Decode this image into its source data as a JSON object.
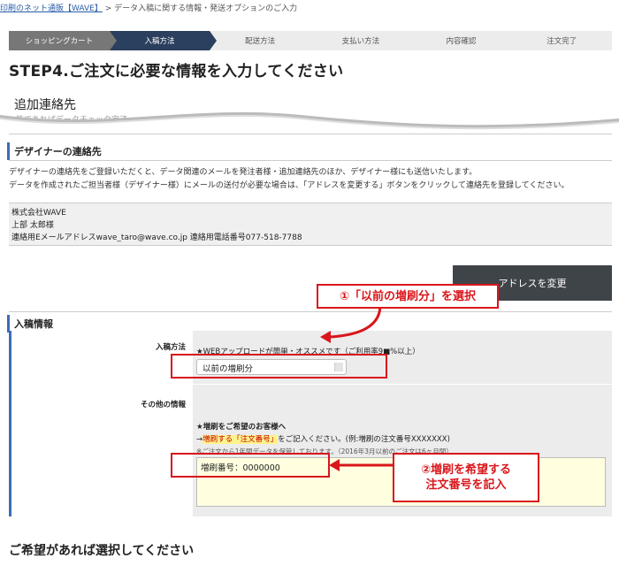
{
  "breadcrumb": {
    "home": "印刷のネット通販【WAVE】",
    "sep": ">",
    "current": "データ入稿に関する情報・発送オプションのご入力"
  },
  "steps": [
    "ショッピングカート",
    "入稿方法",
    "配送方法",
    "支払い方法",
    "内容確認",
    "注文完了"
  ],
  "page_title": "STEP4.ご注文に必要な情報を入力してください",
  "additional_contact": {
    "title": "追加連絡先",
    "partial_text": "能であればデータチェック完了"
  },
  "designer": {
    "title": "デザイナーの連絡先",
    "desc1": "デザイナーの連絡先をご登録いただくと、データ関連のメールを発注者様・追加連絡先のほか、デザイナー様にも送信いたします。",
    "desc2": "データを作成されたご担当者様（デザイナー様）にメールの送付が必要な場合は、「アドレスを変更する」ボタンをクリックして連絡先を登録してください。",
    "company": "株式会社WAVE",
    "name": "上部 太郎様",
    "contact_line": "連絡用Eメールアドレスwave_taro@wave.co.jp 連絡用電話番号077-518-7788",
    "change_button": "アドレスを変更"
  },
  "submission": {
    "title": "入稿情報",
    "method_label": "入稿方法",
    "method_note": "★WEBアップロードが簡単・オススメです（ご利用率9■%以上）",
    "method_value": "以前の増刷分",
    "other_label": "その他の情報",
    "reprint_head": "★増刷をご希望のお客様へ",
    "reprint_pre": "→",
    "reprint_em1": "増刷する「注文番号」",
    "reprint_post": "をご記入ください。(例:増刷の注文番号XXXXXXX)",
    "reprint_note": "※ご注文から1年間データを保管しております。（2016年3月以前のご注文は6ヶ月間）",
    "textarea_value": "増刷番号：0000000"
  },
  "callouts": {
    "one": "①「以前の増刷分」を選択",
    "two_line1": "②増刷を希望する",
    "two_line2": "注文番号を記入"
  },
  "bottom_title": "ご希望があれば選択してください",
  "colors": {
    "accent": "#3e6bb5",
    "current_step": "#2b3f5e",
    "annotation_red": "#d9161b"
  }
}
